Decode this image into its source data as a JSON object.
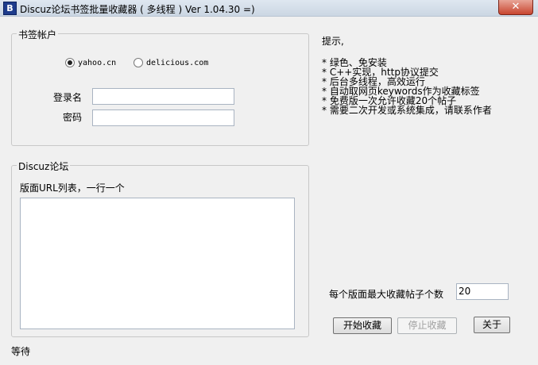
{
  "window": {
    "title": "Discuz论坛书签批量收藏器 ( 多线程 )  Ver 1.04.30  =)",
    "icon": "app-icon",
    "close_label": "✕"
  },
  "account_group": {
    "legend": "书签帐户",
    "radio_options": [
      {
        "label": "yahoo.cn",
        "selected": true
      },
      {
        "label": "delicious.com",
        "selected": false
      }
    ],
    "login_label": "登录名",
    "login_value": "",
    "password_label": "密码",
    "password_value": ""
  },
  "discuz_group": {
    "legend": "Discuz论坛",
    "url_list_label": "版面URL列表，一行一个",
    "url_list_value": ""
  },
  "tips": {
    "title": "提示,",
    "lines": [
      "* 绿色、免安装",
      "* C++实现，http协议提交",
      "* 后台多线程，高效运行",
      "* 自动取网页keywords作为收藏标签",
      "* 免费版一次允许收藏20个帖子",
      "* 需要二次开发或系统集成，请联系作者"
    ]
  },
  "max_posts": {
    "label": "每个版面最大收藏帖子个数",
    "value": "20"
  },
  "buttons": {
    "start": "开始收藏",
    "stop": "停止收藏",
    "about": "关于"
  },
  "status": {
    "text": "等待"
  },
  "colors": {
    "titlebar": "#cbd6e3",
    "close": "#c8452f",
    "background": "#f0f0f0"
  }
}
